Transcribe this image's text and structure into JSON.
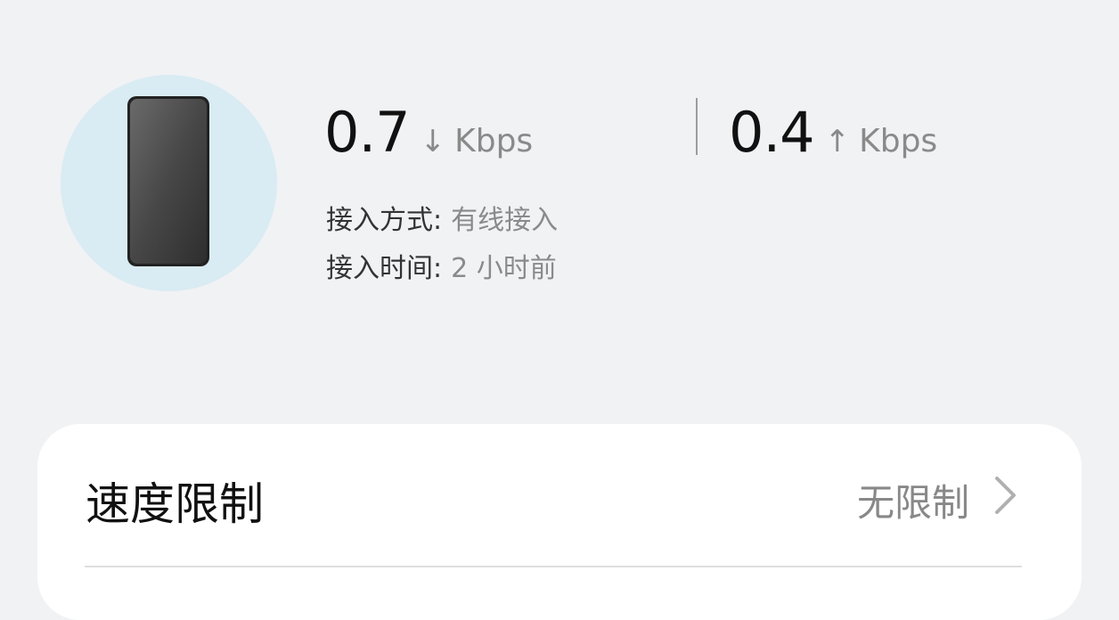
{
  "device": {
    "icon": "smartphone-icon",
    "avatar_bg": "#d9ebf3"
  },
  "download": {
    "value": "0.7",
    "arrow": "↓",
    "unit": "Kbps"
  },
  "upload": {
    "value": "0.4",
    "arrow": "↑",
    "unit": "Kbps"
  },
  "info": {
    "access_method_label": "接入方式:",
    "access_method_value": "有线接入",
    "access_time_label": "接入时间:",
    "access_time_value": "2 小时前"
  },
  "settings": {
    "speed_limit_title": "速度限制",
    "speed_limit_value": "无限制",
    "chevron_icon": "chevron-right-icon"
  },
  "colors": {
    "background": "#f1f2f4",
    "card": "#ffffff",
    "primary_text": "#111111",
    "secondary_text": "#8a8a8a"
  }
}
